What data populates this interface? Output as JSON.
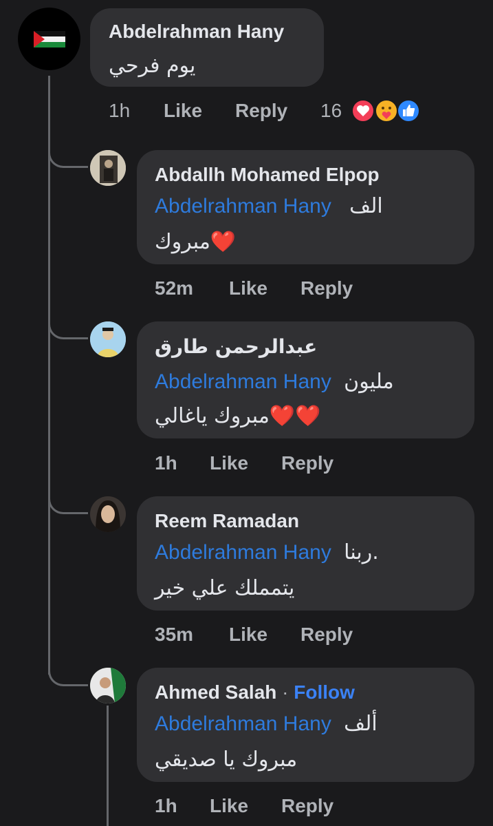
{
  "main_comment": {
    "author": "Abdelrahman Hany",
    "text": "يوم فرحي",
    "time": "1h",
    "like_label": "Like",
    "reply_label": "Reply",
    "reaction_count": "16",
    "reactions": [
      "love-icon",
      "care-icon",
      "like-icon"
    ]
  },
  "replies": [
    {
      "author": "Abdallh Mohamed Elpop",
      "mention": "Abdelrahman Hany",
      "line1_text": "الف",
      "line2_text": "مبروك",
      "line2_emoji": "❤️",
      "time": "52m",
      "like_label": "Like",
      "reply_label": "Reply"
    },
    {
      "author": "عبدالرحمن طارق",
      "mention": "Abdelrahman Hany",
      "line1_text": "مليون",
      "line2_text": "مبروك ياغالي",
      "line2_emoji": "❤️❤️",
      "time": "1h",
      "like_label": "Like",
      "reply_label": "Reply"
    },
    {
      "author": "Reem Ramadan",
      "mention": "Abdelrahman Hany",
      "line1_text": "ربنا.",
      "line2_text": "يتمملك علي خير",
      "time": "35m",
      "like_label": "Like",
      "reply_label": "Reply"
    },
    {
      "author": "Ahmed Salah",
      "separator": "·",
      "follow_label": "Follow",
      "mention": "Abdelrahman Hany",
      "line1_text": "ألف",
      "line2_text": "مبروك يا صديقي",
      "time": "1h",
      "like_label": "Like",
      "reply_label": "Reply"
    }
  ],
  "colors": {
    "background": "#1a1a1c",
    "bubble": "#303033",
    "mention": "#2e7bdd",
    "follow": "#3b82f6",
    "meta": "#b0b3b8"
  }
}
